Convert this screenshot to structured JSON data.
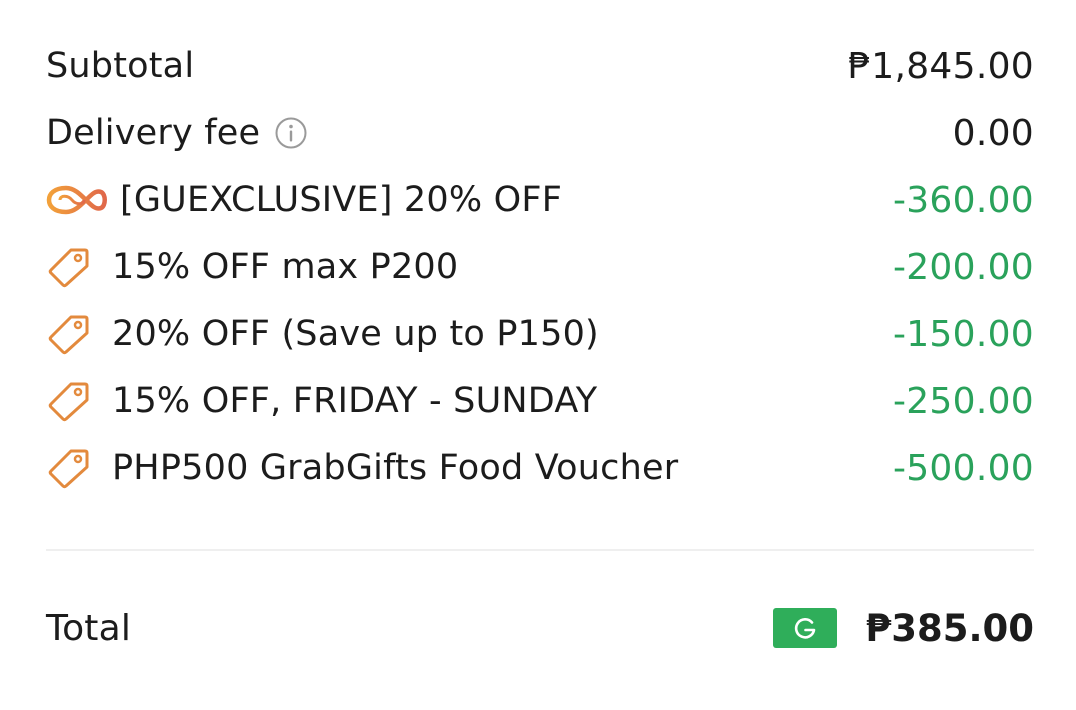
{
  "subtotal": {
    "label": "Subtotal",
    "amount": "₱1,845.00"
  },
  "delivery_fee": {
    "label": "Delivery fee",
    "amount": "0.00",
    "icon": "info-icon"
  },
  "discounts": [
    {
      "label": "[GUEXCLUSIVE] 20% OFF",
      "amount": "-360.00",
      "icon": "promo-subscription-icon"
    },
    {
      "label": "15% OFF max P200",
      "amount": "-200.00",
      "icon": "tag-icon"
    },
    {
      "label": "20% OFF (Save up to P150)",
      "amount": "-150.00",
      "icon": "tag-icon"
    },
    {
      "label": "15% OFF, FRIDAY - SUNDAY",
      "amount": "-250.00",
      "icon": "tag-icon"
    },
    {
      "label": "PHP500 GrabGifts Food Voucher",
      "amount": "-500.00",
      "icon": "tag-icon"
    }
  ],
  "total": {
    "label": "Total",
    "amount": "₱385.00",
    "payment_badge": "G"
  },
  "colors": {
    "discount": "#2aa25b",
    "tag_icon": "#e38a3d",
    "payment_badge": "#2fae5a"
  }
}
